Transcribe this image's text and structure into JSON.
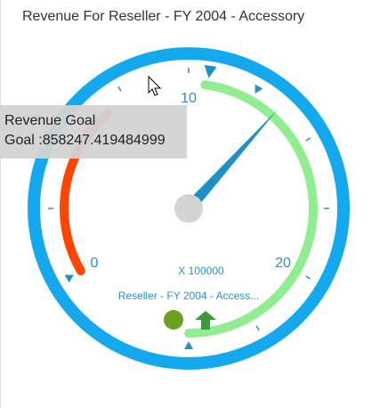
{
  "title": "Revenue For Reseller - FY 2004 - Accessory",
  "gauge": {
    "min": 0,
    "max": 20,
    "min_label": "0",
    "mid_label": "10",
    "max_label": "20",
    "scale_label": "X 100000",
    "caption": "Reseller - FY 2004 - Access...",
    "pointer_value": 10.8,
    "goal_value": 8.58247419484999,
    "red_range": [
      0,
      5.3
    ],
    "green_range": [
      8.5,
      20
    ],
    "colors": {
      "frame": "#14a9ee",
      "red_range": "#ff4500",
      "green_range": "#90ee90",
      "needle": "#1e90c8",
      "hub": "#d3d3d3",
      "tick": "#2a8fc8",
      "label": "#2a8fc8",
      "status_indicator": "#6aa121",
      "trend_arrow": "#3c9a3c"
    },
    "status_icon": "green-circle",
    "trend_icon": "up-arrow"
  },
  "tooltip": {
    "title": "Revenue Goal",
    "text": "Goal :858247.419484999"
  }
}
